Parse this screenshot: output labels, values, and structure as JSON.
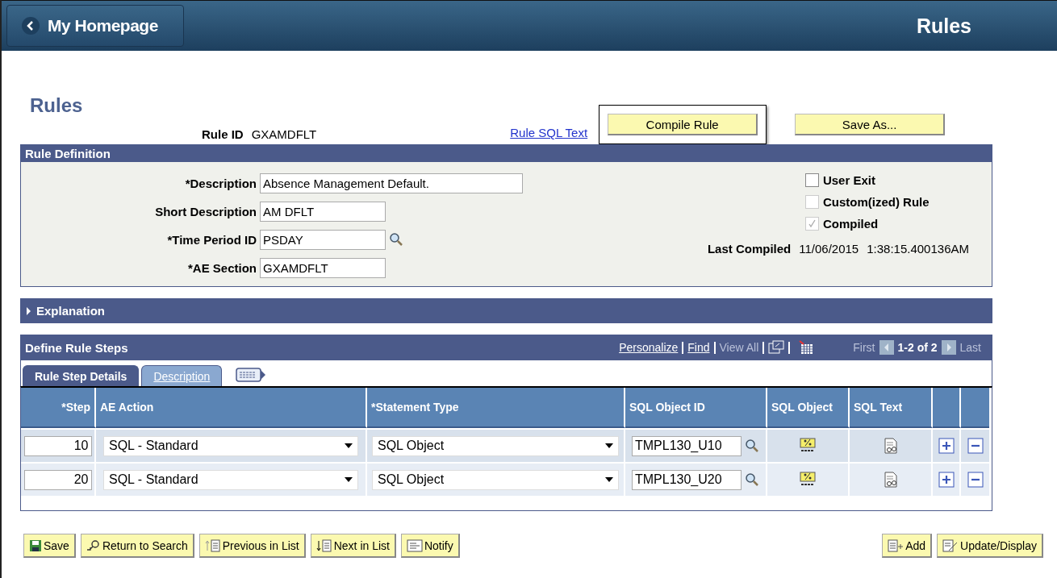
{
  "header": {
    "back_label": "My Homepage",
    "title": "Rules"
  },
  "page_title": "Rules",
  "rule_id": {
    "label": "Rule ID",
    "value": "GXAMDFLT"
  },
  "rule_sql_link": "Rule SQL Text",
  "top_buttons": [
    {
      "label": "Compile Rule",
      "focused": true
    },
    {
      "label": "Save As...",
      "focused": false
    }
  ],
  "rule_definition": {
    "title": "Rule Definition",
    "fields": [
      {
        "label": "*Description",
        "value": "Absence Management Default.",
        "kind": "wide"
      },
      {
        "label": "Short Description",
        "value": "AM DFLT",
        "kind": "short"
      },
      {
        "label": "*Time Period ID",
        "value": "PSDAY",
        "kind": "lookup"
      },
      {
        "label": "*AE Section",
        "value": "GXAMDFLT",
        "kind": "short"
      }
    ],
    "checkboxes": [
      {
        "label": "User Exit",
        "checked": false,
        "disabled": false
      },
      {
        "label": "Custom(ized) Rule",
        "checked": false,
        "disabled": true
      },
      {
        "label": "Compiled",
        "checked": true,
        "disabled": true
      }
    ],
    "last_compiled": {
      "label": "Last Compiled",
      "date": "11/06/2015",
      "time": "1:38:15.400136AM"
    }
  },
  "explanation": {
    "title": "Explanation",
    "expanded": false
  },
  "steps": {
    "title": "Define Rule Steps",
    "nav": {
      "personalize": "Personalize",
      "find": "Find",
      "view_all": "View All",
      "first": "First",
      "range": "1-2 of 2",
      "last": "Last"
    },
    "tabs": [
      {
        "label": "Rule Step Details",
        "selected": true
      },
      {
        "label": "Description",
        "selected": false
      }
    ],
    "columns": [
      "*Step",
      "AE Action",
      "*Statement Type",
      "SQL Object ID",
      "SQL Object",
      "SQL Text"
    ],
    "rows": [
      {
        "step": "10",
        "action": "SQL - Standard",
        "statement_type": "SQL Object",
        "object_id": "TMPL130_U10"
      },
      {
        "step": "20",
        "action": "SQL - Standard",
        "statement_type": "SQL Object",
        "object_id": "TMPL130_U20"
      }
    ]
  },
  "toolbar_left": [
    {
      "label": "Save",
      "kind": "save"
    },
    {
      "label": "Return to Search",
      "kind": "search"
    },
    {
      "label": "Previous in List",
      "kind": "previous"
    },
    {
      "label": "Next in List",
      "kind": "next"
    },
    {
      "label": "Notify",
      "kind": "notify"
    }
  ],
  "toolbar_right": [
    {
      "label": "Add",
      "kind": "add"
    },
    {
      "label": "Update/Display",
      "kind": "update"
    }
  ]
}
